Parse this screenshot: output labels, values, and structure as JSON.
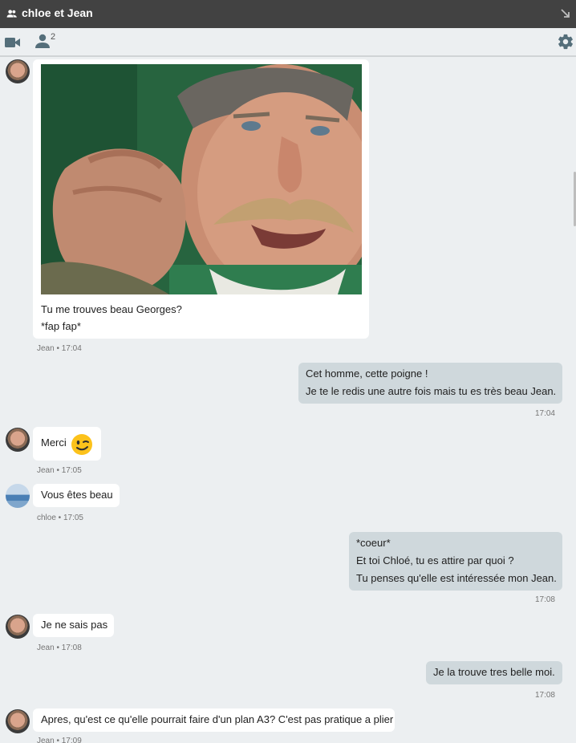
{
  "window": {
    "title": "chloe et Jean"
  },
  "toolbar": {
    "participant_count": "2"
  },
  "messages": [
    {
      "sender": "Jean",
      "lines": [
        "Tu me trouves beau Georges?",
        "*fap fap*"
      ],
      "meta": "Jean • 17:04",
      "has_photo": true
    },
    {
      "sender": "me",
      "lines": [
        "Cet homme, cette poigne !",
        "Je te le redis une autre fois mais tu es très beau Jean."
      ],
      "meta": "17:04"
    },
    {
      "sender": "Jean",
      "lines": [
        "Merci"
      ],
      "meta": "Jean • 17:05",
      "emoji": "winking-face"
    },
    {
      "sender": "chloe",
      "lines": [
        "Vous êtes beau"
      ],
      "meta": "chloe • 17:05"
    },
    {
      "sender": "me",
      "lines": [
        "*coeur*",
        "Et toi Chloé, tu es attire par quoi ?",
        "Tu penses qu'elle est intéressée mon Jean."
      ],
      "meta": "17:08"
    },
    {
      "sender": "Jean",
      "lines": [
        "Je ne sais pas"
      ],
      "meta": "Jean • 17:08"
    },
    {
      "sender": "me",
      "lines": [
        "Je la trouve tres belle moi."
      ],
      "meta": "17:08"
    },
    {
      "sender": "Jean",
      "lines": [
        "Apres, qu'est ce qu'elle pourrait faire d'un plan A3? C'est pas pratique a plier"
      ],
      "meta": "Jean • 17:09"
    }
  ],
  "colors": {
    "titlebar": "#424242",
    "background": "#eceff1",
    "outgoing_bubble": "#cfd8dc",
    "incoming_bubble": "#ffffff"
  },
  "icons": [
    "people-icon",
    "collapse-icon",
    "video-icon",
    "person-icon",
    "gear-icon",
    "winking-face-emoji"
  ]
}
